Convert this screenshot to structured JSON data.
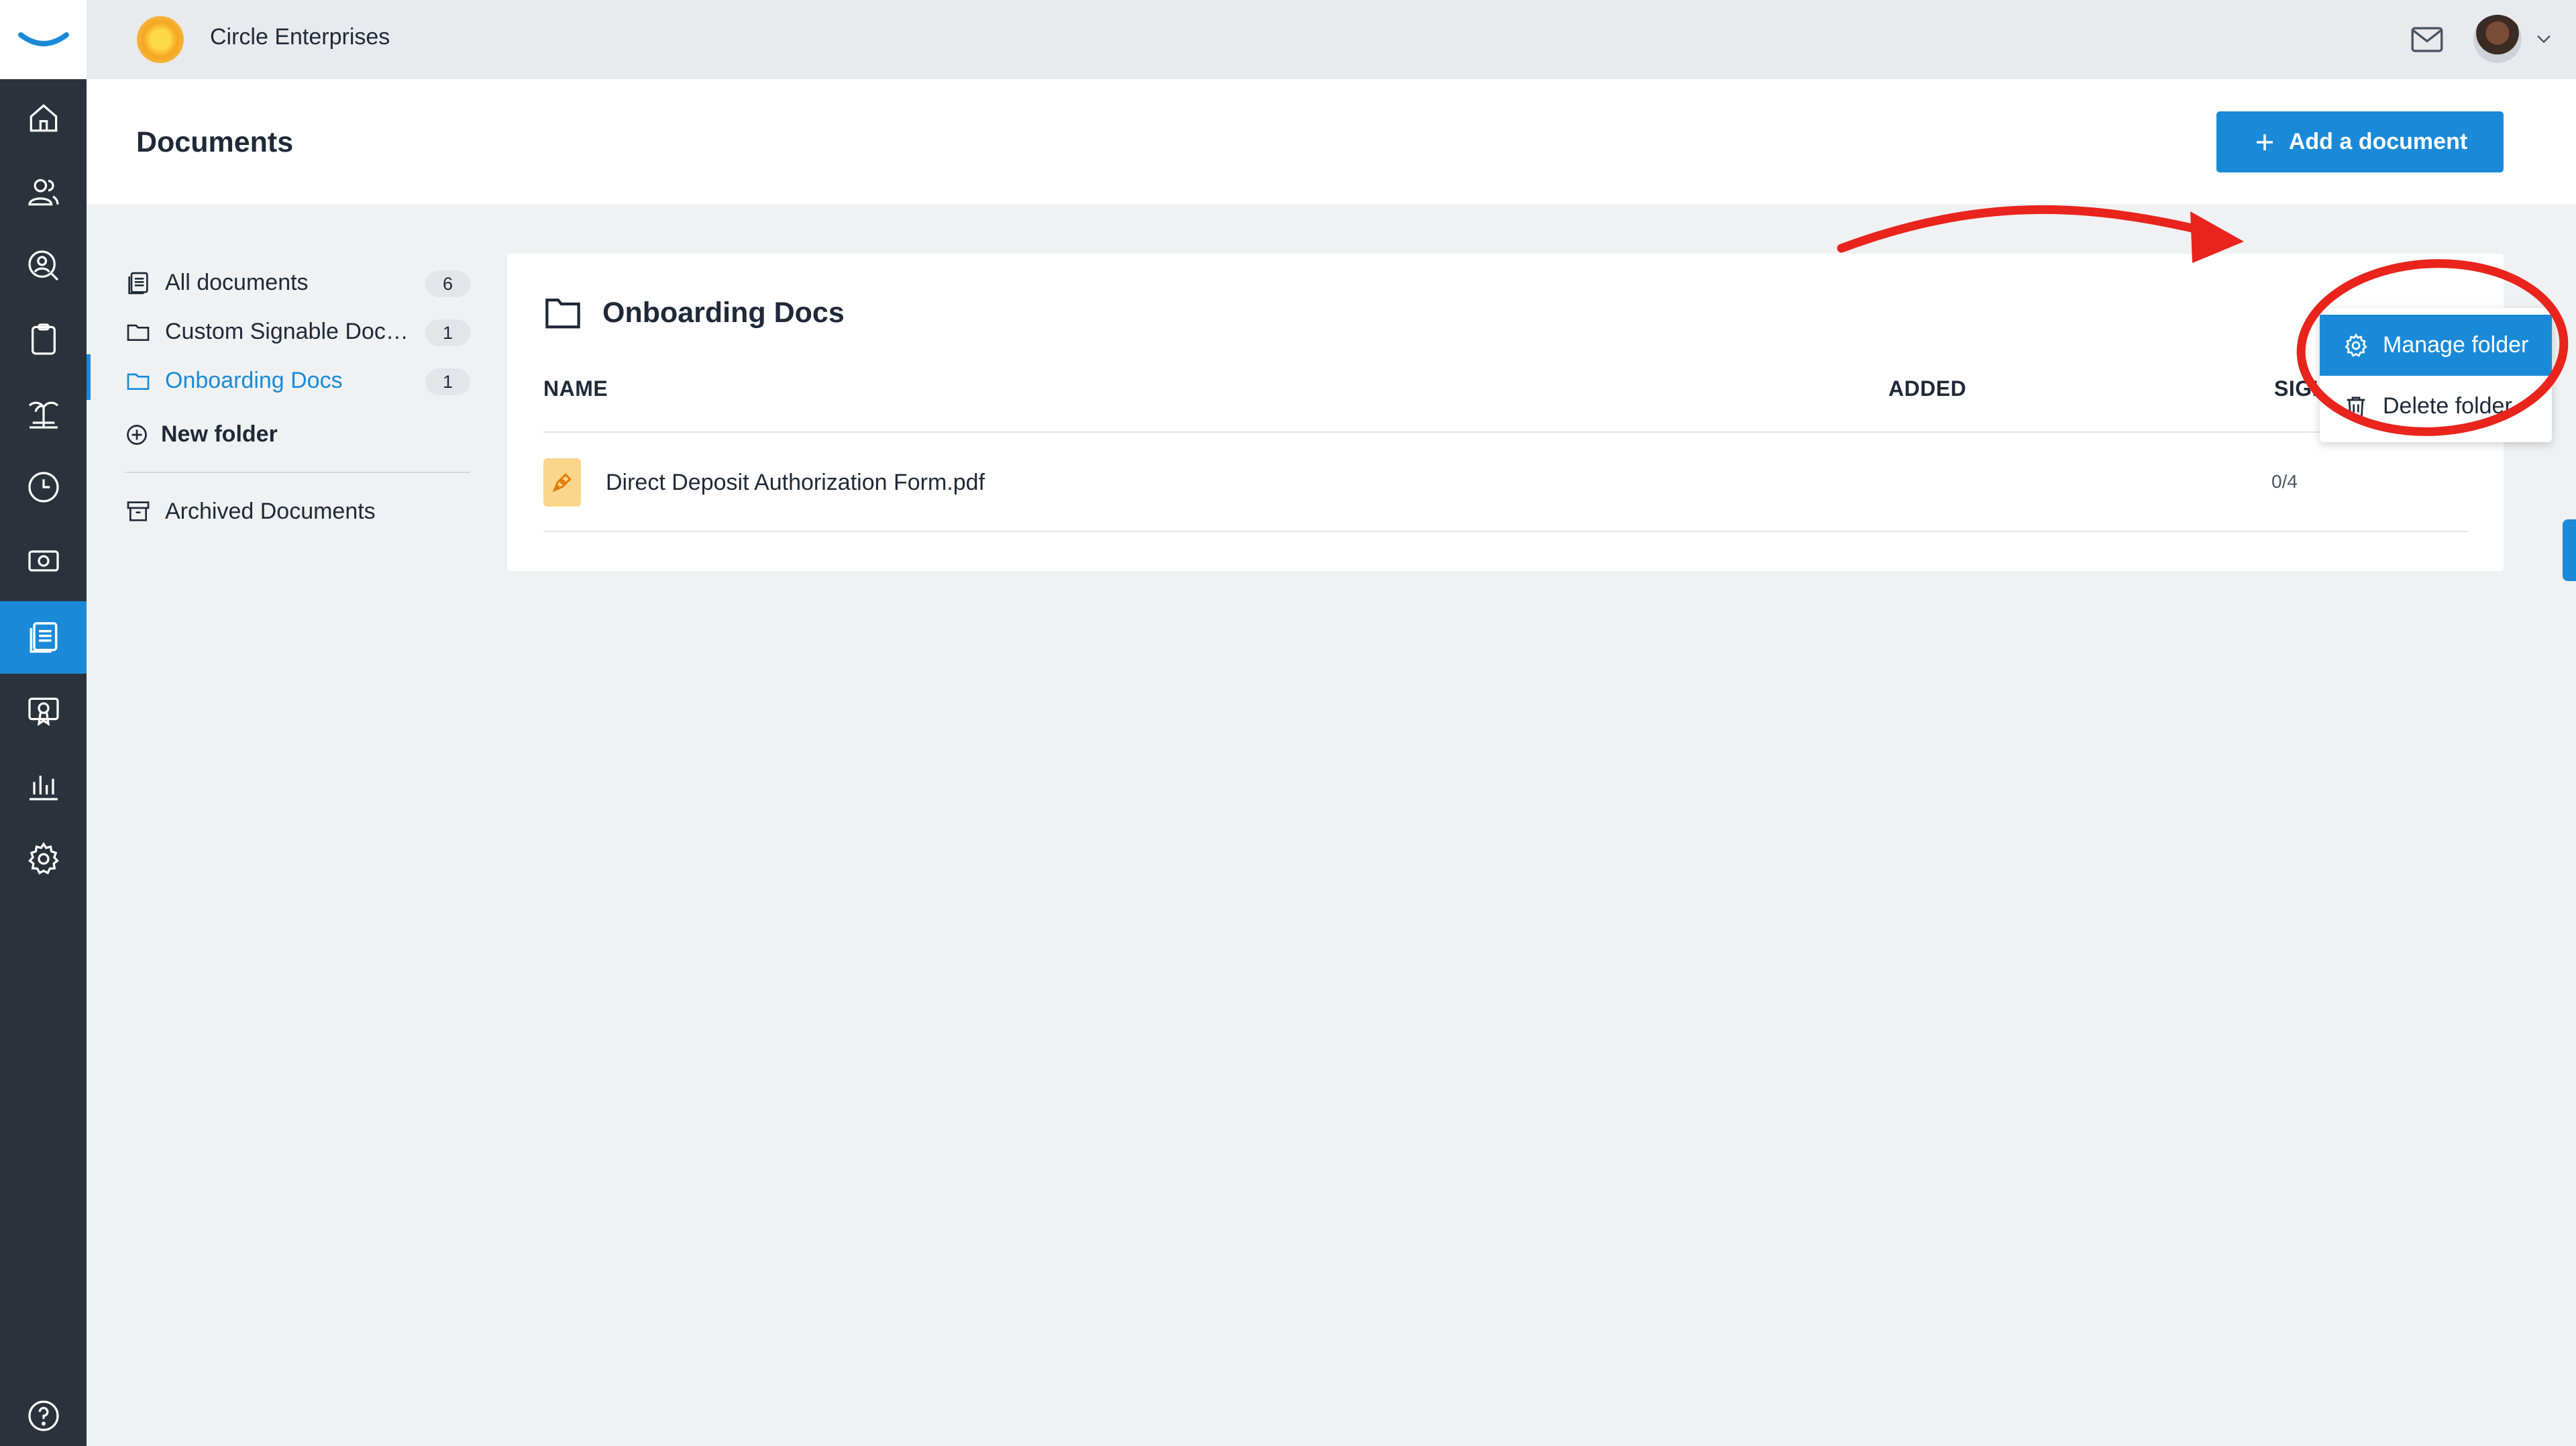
{
  "topbar": {
    "company_name": "Circle Enterprises"
  },
  "nav": {
    "items": [
      "home-icon",
      "people-icon",
      "search-person-icon",
      "clipboard-icon",
      "vacation-icon",
      "clock-icon",
      "money-icon",
      "documents-icon",
      "training-icon",
      "reports-icon",
      "settings-icon",
      "help-icon"
    ],
    "active": "documents-icon"
  },
  "header": {
    "title": "Documents",
    "add_button_label": "Add a document"
  },
  "folders": {
    "items": [
      {
        "label": "All documents",
        "count": "6",
        "icon": "documents-stack-icon"
      },
      {
        "label": "Custom Signable Doc…",
        "count": "1",
        "icon": "folder-icon"
      },
      {
        "label": "Onboarding Docs",
        "count": "1",
        "icon": "folder-icon",
        "active": true
      }
    ],
    "new_folder_label": "New folder",
    "archived_label": "Archived Documents"
  },
  "folder_view": {
    "title": "Onboarding Docs",
    "columns": {
      "name": "NAME",
      "added": "ADDED",
      "signatures": "SIGI"
    },
    "rows": [
      {
        "name": "Direct Deposit Authorization Form.pdf",
        "added": "",
        "signatures": "0/4"
      }
    ]
  },
  "dropdown": {
    "manage_label": "Manage folder",
    "delete_label": "Delete folder"
  },
  "colors": {
    "accent": "#1a8ad8",
    "rail": "#2b323b",
    "annotation": "#e8241c"
  }
}
